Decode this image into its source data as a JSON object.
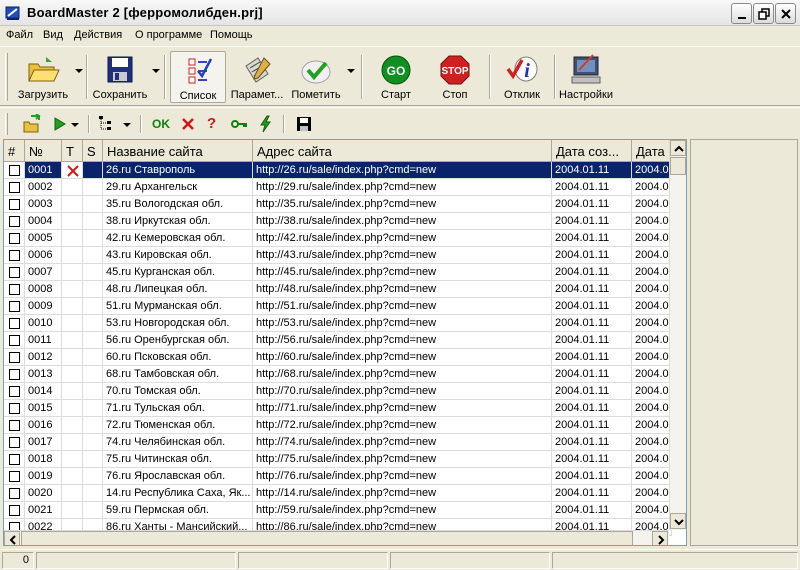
{
  "window": {
    "title": "BoardMaster 2  [ферромолибден.prj]"
  },
  "menu": [
    "Файл",
    "Вид",
    "Действия",
    "О программе",
    "Помощь"
  ],
  "toolbar": {
    "load": "Загрузить",
    "save": "Сохранить",
    "list": "Список",
    "params": "Парамет...",
    "mark": "Пометить",
    "start": "Старт",
    "stop": "Стоп",
    "response": "Отклик",
    "settings": "Настройки",
    "start_icon_text": "GO",
    "stop_icon_text": "STOP"
  },
  "smalltoolbar": {
    "ok": "OK",
    "question": "?"
  },
  "grid": {
    "columns": [
      "#",
      "№",
      "T",
      "S",
      "Название сайта",
      "Адрес сайта",
      "Дата соз...",
      "Дата"
    ],
    "rows": [
      {
        "num": "0001",
        "name": "26.ru Ставрополь",
        "url": "http://26.ru/sale/index.php?cmd=new",
        "date": "2004.01.11",
        "date2": "2004.0",
        "t": "x",
        "selected": true
      },
      {
        "num": "0002",
        "name": "29.ru Архангельск",
        "url": "http://29.ru/sale/index.php?cmd=new",
        "date": "2004.01.11",
        "date2": "2004.0"
      },
      {
        "num": "0003",
        "name": "35.ru Вологодская обл.",
        "url": "http://35.ru/sale/index.php?cmd=new",
        "date": "2004.01.11",
        "date2": "2004.0"
      },
      {
        "num": "0004",
        "name": "38.ru Иркутская обл.",
        "url": "http://38.ru/sale/index.php?cmd=new",
        "date": "2004.01.11",
        "date2": "2004.0"
      },
      {
        "num": "0005",
        "name": "42.ru Кемеровская обл.",
        "url": "http://42.ru/sale/index.php?cmd=new",
        "date": "2004.01.11",
        "date2": "2004.0"
      },
      {
        "num": "0006",
        "name": "43.ru Кировская обл.",
        "url": "http://43.ru/sale/index.php?cmd=new",
        "date": "2004.01.11",
        "date2": "2004.0"
      },
      {
        "num": "0007",
        "name": "45.ru Курганская обл.",
        "url": "http://45.ru/sale/index.php?cmd=new",
        "date": "2004.01.11",
        "date2": "2004.0"
      },
      {
        "num": "0008",
        "name": "48.ru Липецкая обл.",
        "url": "http://48.ru/sale/index.php?cmd=new",
        "date": "2004.01.11",
        "date2": "2004.0"
      },
      {
        "num": "0009",
        "name": "51.ru Мурманская обл.",
        "url": "http://51.ru/sale/index.php?cmd=new",
        "date": "2004.01.11",
        "date2": "2004.0"
      },
      {
        "num": "0010",
        "name": "53.ru Новгородская обл.",
        "url": "http://53.ru/sale/index.php?cmd=new",
        "date": "2004.01.11",
        "date2": "2004.0"
      },
      {
        "num": "0011",
        "name": "56.ru Оренбургская обл.",
        "url": "http://56.ru/sale/index.php?cmd=new",
        "date": "2004.01.11",
        "date2": "2004.0"
      },
      {
        "num": "0012",
        "name": "60.ru Псковская обл.",
        "url": "http://60.ru/sale/index.php?cmd=new",
        "date": "2004.01.11",
        "date2": "2004.0"
      },
      {
        "num": "0013",
        "name": "68.ru Тамбовская обл.",
        "url": "http://68.ru/sale/index.php?cmd=new",
        "date": "2004.01.11",
        "date2": "2004.0"
      },
      {
        "num": "0014",
        "name": "70.ru Томская обл.",
        "url": "http://70.ru/sale/index.php?cmd=new",
        "date": "2004.01.11",
        "date2": "2004.0"
      },
      {
        "num": "0015",
        "name": "71.ru Тульская обл.",
        "url": "http://71.ru/sale/index.php?cmd=new",
        "date": "2004.01.11",
        "date2": "2004.0"
      },
      {
        "num": "0016",
        "name": "72.ru Тюменская обл.",
        "url": "http://72.ru/sale/index.php?cmd=new",
        "date": "2004.01.11",
        "date2": "2004.0"
      },
      {
        "num": "0017",
        "name": "74.ru Челябинская обл.",
        "url": "http://74.ru/sale/index.php?cmd=new",
        "date": "2004.01.11",
        "date2": "2004.0"
      },
      {
        "num": "0018",
        "name": "75.ru Читинская обл.",
        "url": "http://75.ru/sale/index.php?cmd=new",
        "date": "2004.01.11",
        "date2": "2004.0"
      },
      {
        "num": "0019",
        "name": "76.ru Ярославская обл.",
        "url": "http://76.ru/sale/index.php?cmd=new",
        "date": "2004.01.11",
        "date2": "2004.0"
      },
      {
        "num": "0020",
        "name": "14.ru Республика Саха, Як...",
        "url": "http://14.ru/sale/index.php?cmd=new",
        "date": "2004.01.11",
        "date2": "2004.0"
      },
      {
        "num": "0021",
        "name": "59.ru Пермская обл.",
        "url": "http://59.ru/sale/index.php?cmd=new",
        "date": "2004.01.11",
        "date2": "2004.0"
      },
      {
        "num": "0022",
        "name": "86.ru Ханты - Мансийский...",
        "url": "http://86.ru/sale/index.php?cmd=new",
        "date": "2004.01.11",
        "date2": "2004.0"
      }
    ]
  },
  "status": {
    "count": "0"
  },
  "colors": {
    "selection": "#0a246a",
    "face": "#ece9d8",
    "delete_x": "#d01818"
  }
}
